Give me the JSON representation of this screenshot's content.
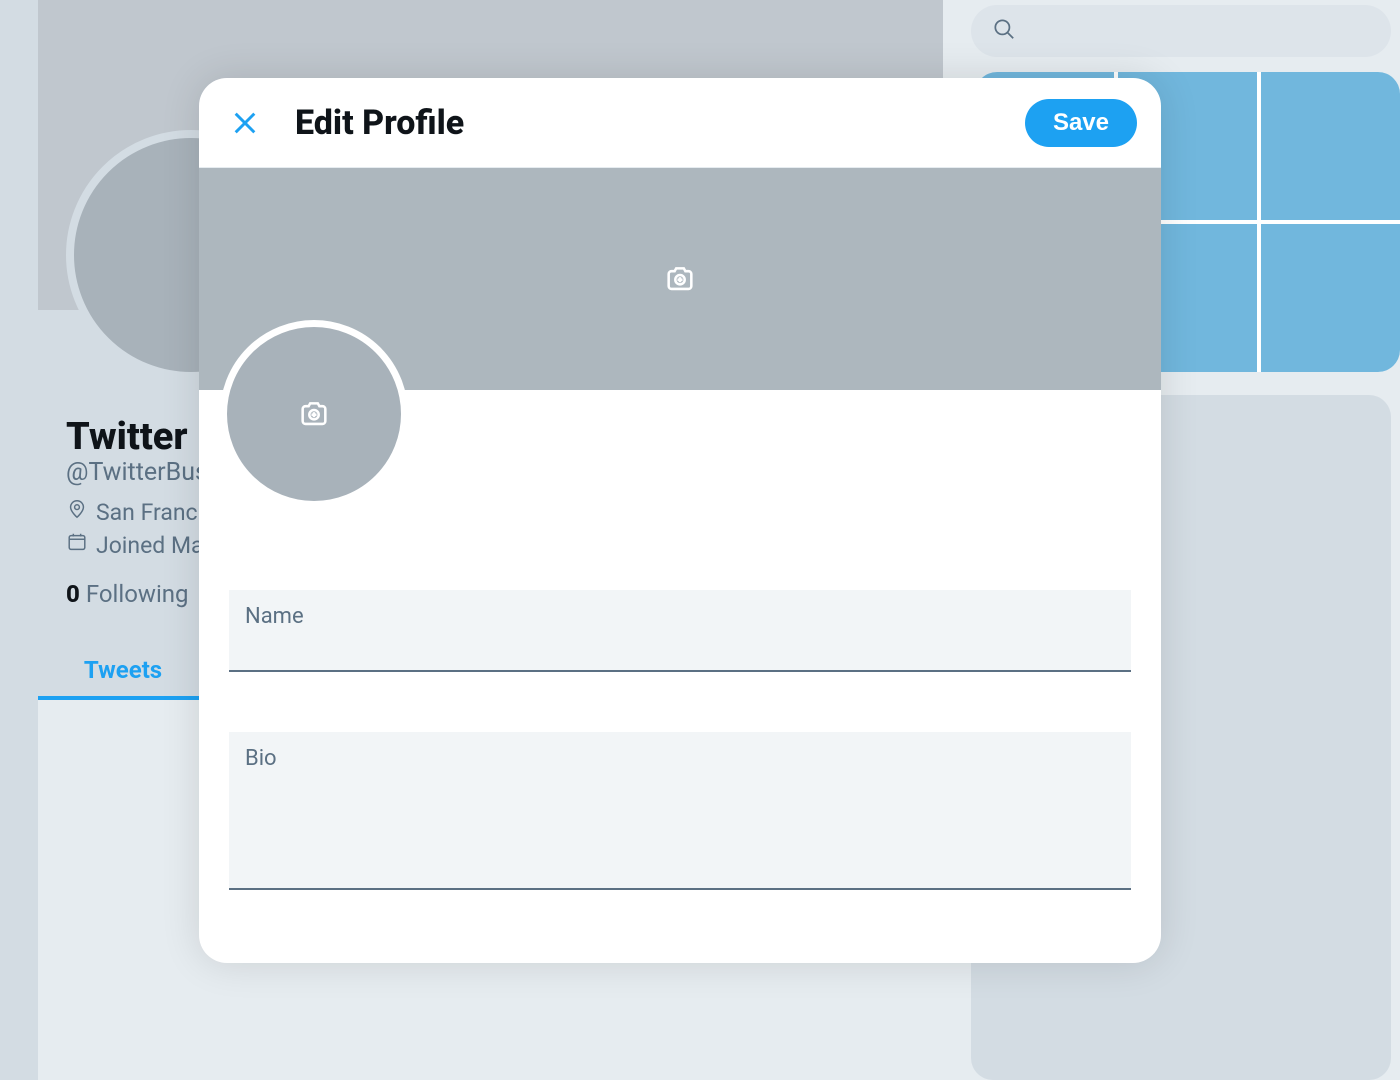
{
  "modal": {
    "title": "Edit Profile",
    "save_label": "Save",
    "name_label": "Name",
    "name_value": "",
    "bio_label": "Bio",
    "bio_value": ""
  },
  "profile_bg": {
    "display_name": "Twitter Business",
    "handle": "@TwitterBusiness",
    "location": "San Francisco",
    "joined": "Joined May",
    "following_count": "0",
    "following_label": "Following",
    "tab_tweets": "Tweets"
  },
  "search": {
    "placeholder": ""
  }
}
